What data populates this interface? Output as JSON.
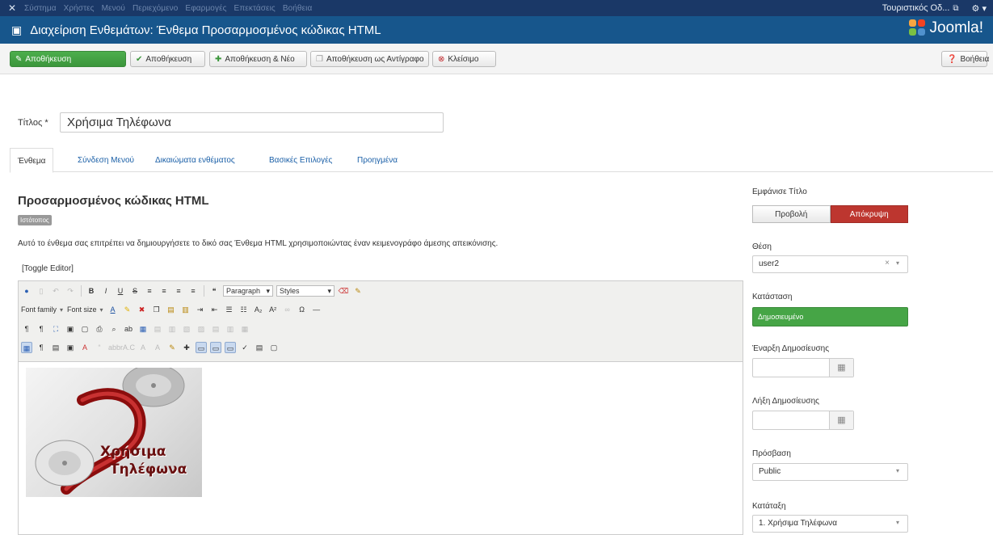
{
  "topbar": {
    "menu": [
      "Σύστημα",
      "Χρήστες",
      "Μενού",
      "Περιεχόμενο",
      "Εφαρμογές",
      "Επεκτάσεις",
      "Βοήθεια"
    ],
    "site_name": "Τουριστικός Οδ...",
    "external_icon": "external-link-icon",
    "gear_icon": "gear-icon"
  },
  "header": {
    "title": "Διαχείριση Ενθεμάτων: Ένθεμα Προσαρμοσμένος κώδικας HTML",
    "brand": "Joomla!"
  },
  "toolbar": {
    "save": "Αποθήκευση",
    "save_close": "Αποθήκευση",
    "save_new": "Αποθήκευση & Νέο",
    "save_copy": "Αποθήκευση ως Αντίγραφο",
    "close": "Κλείσιμο",
    "help": "Βοήθεια"
  },
  "form": {
    "title_label": "Τίτλος *",
    "title_value": "Χρήσιμα Τηλέφωνα"
  },
  "tabs": [
    "Ένθεμα",
    "Σύνδεση Μενού",
    "Δικαιώματα ενθέματος",
    "Βασικές Επιλογές",
    "Προηγμένα"
  ],
  "module": {
    "heading": "Προσαρμοσμένος κώδικας HTML",
    "badge": "Ιστότοπος",
    "description": "Αυτό το ένθεμα σας επιτρέπει να δημιουργήσετε το δικό σας Ένθεμα HTML χρησιμοποιώντας έναν κειμενογράφο άμεσης απεικόνισης.",
    "toggle_editor": "[Toggle Editor]"
  },
  "editor": {
    "format_select": "Paragraph",
    "styles_select": "Styles",
    "font_family": "Font family",
    "font_size": "Font size",
    "image_text_line1": "Χρήσιμα",
    "image_text_line2": "Τηλέφωνα"
  },
  "sidebar": {
    "show_title_label": "Εμφάνισε Τίτλο",
    "show": "Προβολή",
    "hide": "Απόκρυψη",
    "position_label": "Θέση",
    "position_value": "user2",
    "status_label": "Κατάσταση",
    "status_value": "Δημοσιευμένο",
    "publish_up_label": "Έναρξη Δημοσίευσης",
    "publish_down_label": "Λήξη Δημοσίευσης",
    "access_label": "Πρόσβαση",
    "access_value": "Public",
    "ordering_label": "Κατάταξη",
    "ordering_value": "1. Χρήσιμα Τηλέφωνα"
  },
  "colors": {
    "navbar": "#1a3867",
    "header": "#17568c",
    "save_green": "#46a546",
    "hide_red": "#bd362f"
  }
}
